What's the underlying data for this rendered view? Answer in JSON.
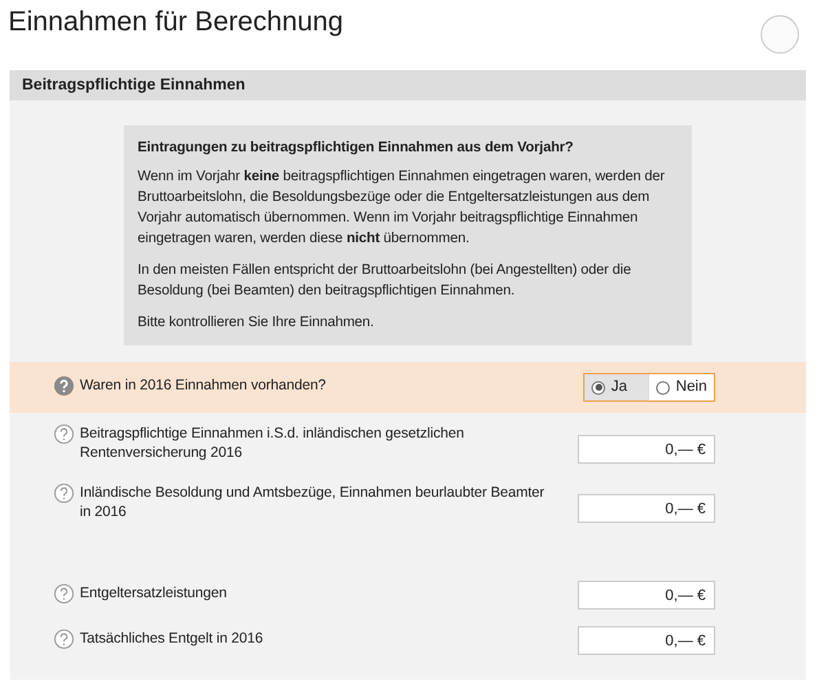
{
  "title": "Einnahmen für Berechnung",
  "section": {
    "header": "Beitragspflichtige Einnahmen",
    "info": {
      "heading": "Eintragungen zu beitragspflichtigen Einnahmen aus dem Vorjahr?",
      "paragraphs": [
        "Wenn im Vorjahr **keine** beitragspflichtigen Einnahmen eingetragen waren, werden der Bruttoarbeitslohn, die Besoldungsbezüge oder die Entgeltersatzleistungen aus dem Vorjahr automatisch übernommen. Wenn im Vorjahr beitragspflichtige Einnahmen eingetragen waren, werden diese **nicht** übernommen.",
        "In den meisten Fällen entspricht der Bruttoarbeitslohn (bei Angestellten) oder die Besoldung (bei Beamten) den beitragspflichtigen Einnahmen.",
        "Bitte kontrollieren Sie Ihre Einnahmen."
      ]
    },
    "row_groups": [
      [
        {
          "kind": "radio",
          "highlighted": true,
          "label": "Waren in 2016 Einnahmen vorhanden?",
          "options": [
            {
              "label": "Ja",
              "selected": true
            },
            {
              "label": "Nein",
              "selected": false
            }
          ]
        },
        {
          "kind": "amount",
          "highlighted": false,
          "label": "Beitragspflichtige Einnahmen i.S.d. inländischen gesetzlichen Rentenversicherung 2016",
          "value": "0,— €"
        },
        {
          "kind": "amount",
          "highlighted": false,
          "label": "Inländische Besoldung und Amtsbezüge, Einnahmen beurlaubter Beamter in 2016",
          "value": "0,— €"
        }
      ],
      [
        {
          "kind": "amount",
          "highlighted": false,
          "label": "Entgeltersatzleistungen",
          "value": "0,— €"
        },
        {
          "kind": "amount",
          "highlighted": false,
          "label": "Tatsächliches Entgelt in 2016",
          "value": "0,— €"
        }
      ]
    ]
  }
}
